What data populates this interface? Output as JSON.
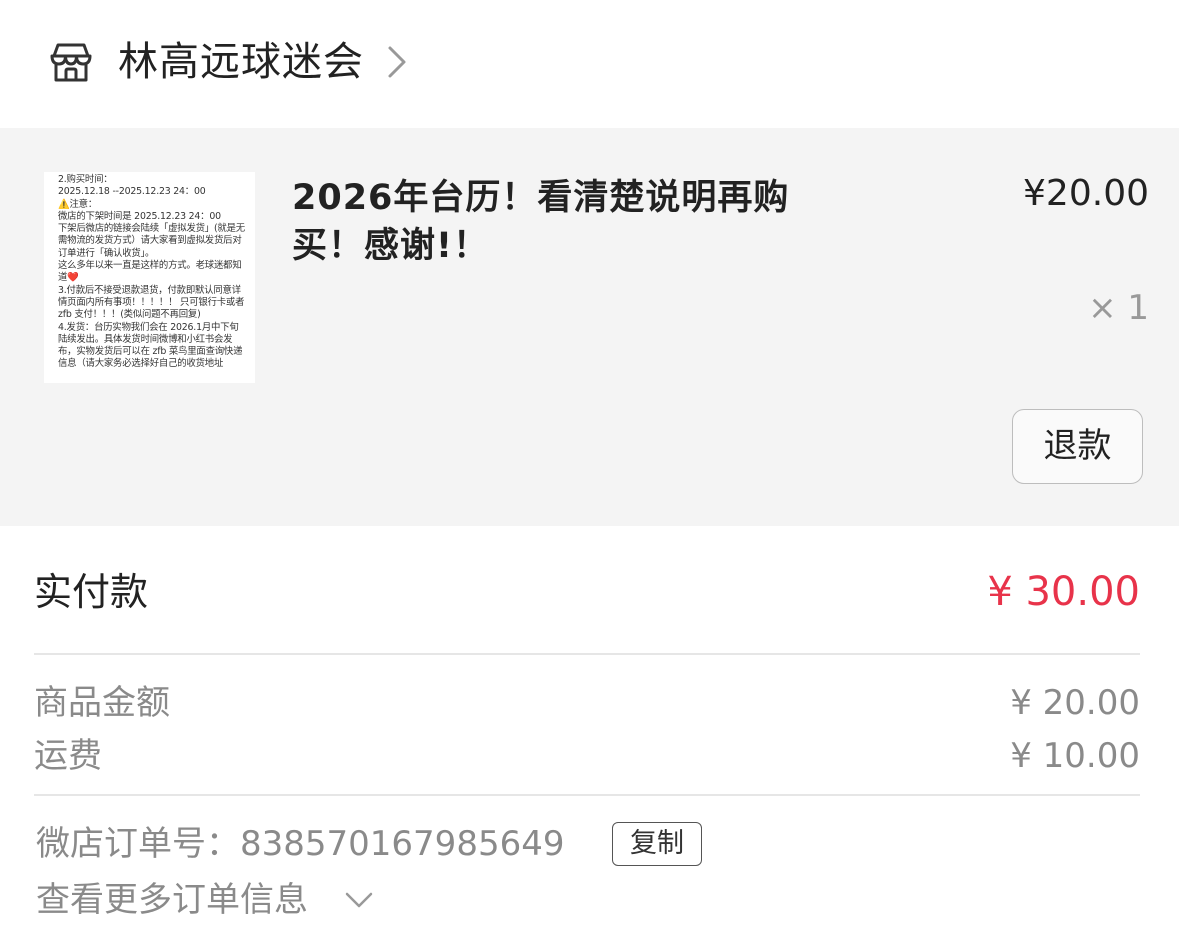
{
  "shop": {
    "name": "林高远球迷会",
    "icon": "shop-icon"
  },
  "item": {
    "title": "2026年台历！看清楚说明再购买！感谢!！",
    "price": "¥20.00",
    "quantity": "× 1",
    "refund_label": "退款",
    "thumbnail_text": [
      "2.购买时间：",
      "2025.12.18 --2025.12.23 24：00",
      "⚠️注意：",
      "微店的下架时间是 2025.12.23 24：00",
      "下架后微店的链接会陆续「虚拟发货」(就是无",
      "需物流的发货方式）请大家看到虚拟发货后对",
      "订单进行「确认收货」。",
      "这么多年以来一直是这样的方式。老球迷都知",
      "道❤️",
      "3.付款后不接受退款退货，付款即默认同意详",
      "情页面内所有事项！！！！！ 只可银行卡或者",
      " zfb 支付！！！(类似问题不再回复)",
      "4.发货：台历实物我们会在 2026.1月中下旬",
      "陆续发出。具体发货时间微博和小红书会发",
      "布，实物发货后可以在 zfb 菜鸟里面查询快递",
      "信息（请大家务必选择好自己的收货地址"
    ]
  },
  "payment": {
    "paid_label": "实付款",
    "paid_amount": "¥ 30.00",
    "goods_label": "商品金额",
    "goods_amount": "¥ 20.00",
    "shipping_label": "运费",
    "shipping_amount": "¥ 10.00"
  },
  "order": {
    "number_label": "微店订单号：838570167985649",
    "copy_label": "复制",
    "more_label": "查看更多订单信息"
  },
  "colors": {
    "accent_red": "#e8334a",
    "panel_bg": "#f4f4f4",
    "muted_text": "#8a8a8a"
  }
}
